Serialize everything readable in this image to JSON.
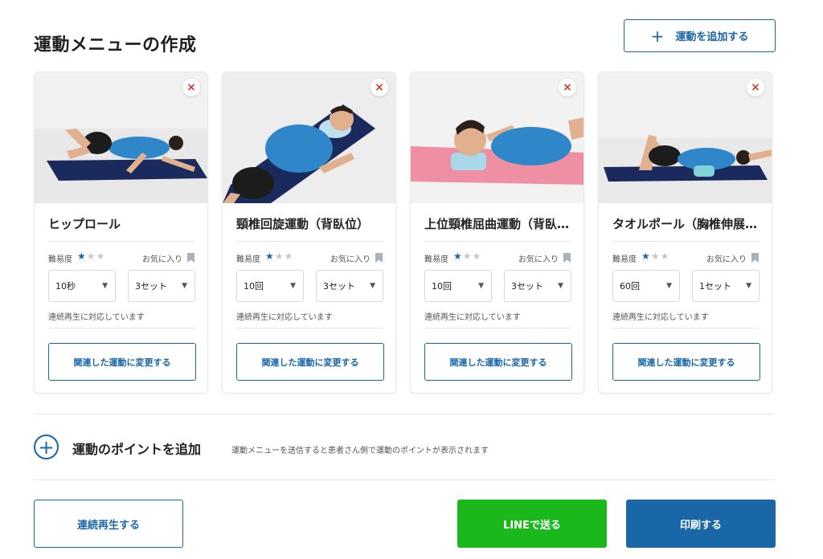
{
  "header": {
    "title": "運動メニューの作成",
    "add_button_label": "運動を追加する"
  },
  "common": {
    "difficulty_label": "難易度",
    "favorite_label": "お気に入り",
    "continuous_note": "連続再生に対応しています",
    "related_button_label": "関連した運動に変更する",
    "remove_icon": "×",
    "star_on": "★",
    "star_off": "★"
  },
  "cards": [
    {
      "name": "ヒップロール",
      "difficulty": 1,
      "difficulty_max": 3,
      "amount": "10秒",
      "sets": "3セット"
    },
    {
      "name": "頸椎回旋運動（背臥位）",
      "difficulty": 1,
      "difficulty_max": 3,
      "amount": "10回",
      "sets": "3セット"
    },
    {
      "name": "上位頸椎屈曲運動（背臥位）",
      "difficulty": 1,
      "difficulty_max": 3,
      "amount": "10回",
      "sets": "3セット"
    },
    {
      "name": "タオルポール（胸椎伸展運動）",
      "difficulty": 1,
      "difficulty_max": 3,
      "amount": "60回",
      "sets": "1セット"
    }
  ],
  "points": {
    "title": "運動のポイントを追加",
    "note": "運動メニューを送信すると患者さん側で運動のポイントが表示されます"
  },
  "footer": {
    "continuous_play_label": "連続再生する",
    "line_send_label": "LINEで送る",
    "print_label": "印刷する"
  },
  "colors": {
    "accent": "#1a67a8",
    "line_green": "#1bb81b",
    "remove_red": "#d33a2c"
  },
  "icons": {
    "add": "plus-icon",
    "remove": "close-icon",
    "favorite": "bookmark-icon",
    "select": "caret-down-icon",
    "difficulty": "star-icon"
  }
}
